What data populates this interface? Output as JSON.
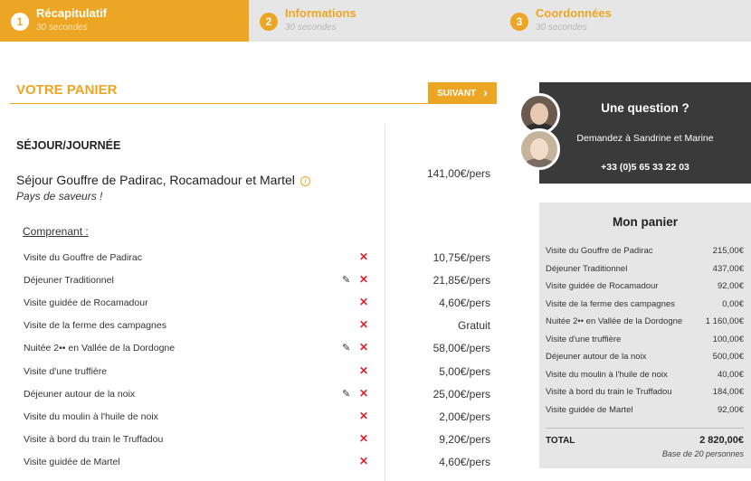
{
  "steps": [
    {
      "number": "1",
      "title": "Récapitulatif",
      "subtitle": "30 secondes"
    },
    {
      "number": "2",
      "title": "Informations",
      "subtitle": "30 secondes"
    },
    {
      "number": "3",
      "title": "Coordonnées",
      "subtitle": "30 secondes"
    }
  ],
  "panier": {
    "title": "VOTRE PANIER",
    "next_label": "SUIVANT",
    "section_title": "SÉJOUR/JOURNÉE",
    "sejour_name": "Séjour Gouffre de Padirac, Rocamadour et Martel",
    "sejour_subtitle": "Pays de saveurs !",
    "sejour_price": "141,00€/pers",
    "comprenant_label": "Comprenant :",
    "items": [
      {
        "name": "Visite du Gouffre de Padirac",
        "price": "10,75€/pers",
        "editable": false
      },
      {
        "name": "Déjeuner Traditionnel",
        "price": "21,85€/pers",
        "editable": true
      },
      {
        "name": "Visite guidée de Rocamadour",
        "price": "4,60€/pers",
        "editable": false
      },
      {
        "name": "Visite de la ferme des campagnes",
        "price": "Gratuit",
        "editable": false
      },
      {
        "name": "Nuitée 2•• en Vallée de la Dordogne",
        "price": "58,00€/pers",
        "editable": true
      },
      {
        "name": "Visite d'une truffière",
        "price": "5,00€/pers",
        "editable": false
      },
      {
        "name": "Déjeuner autour de la noix",
        "price": "25,00€/pers",
        "editable": true
      },
      {
        "name": "Visite du moulin à l'huile de noix",
        "price": "2,00€/pers",
        "editable": false
      },
      {
        "name": "Visite à bord du train le Truffadou",
        "price": "9,20€/pers",
        "editable": false
      },
      {
        "name": "Visite guidée de Martel",
        "price": "4,60€/pers",
        "editable": false
      }
    ]
  },
  "question": {
    "title": "Une question ?",
    "subtitle": "Demandez à Sandrine et Marine",
    "phone": "+33 (0)5 65 33 22 03"
  },
  "cart": {
    "title": "Mon panier",
    "rows": [
      {
        "name": "Visite du Gouffre de Padirac",
        "value": "215,00€"
      },
      {
        "name": "Déjeuner Traditionnel",
        "value": "437,00€"
      },
      {
        "name": "Visite guidée de Rocamadour",
        "value": "92,00€"
      },
      {
        "name": "Visite de la ferme des campagnes",
        "value": "0,00€"
      },
      {
        "name": "Nuitée 2•• en Vallée de la Dordogne",
        "value": "1 160,00€"
      },
      {
        "name": "Visite d'une truffière",
        "value": "100,00€"
      },
      {
        "name": "Déjeuner autour de la noix",
        "value": "500,00€"
      },
      {
        "name": "Visite du moulin à l'huile de noix",
        "value": "40,00€"
      },
      {
        "name": "Visite à bord du train le Truffadou",
        "value": "184,00€"
      },
      {
        "name": "Visite guidée de Martel",
        "value": "92,00€"
      }
    ],
    "total_label": "TOTAL",
    "total_value": "2 820,00€",
    "base_note": "Base de 20 personnes"
  },
  "colors": {
    "accent": "#eda624",
    "delete": "#e0242f",
    "dark_box": "#3a3a3a",
    "cart_bg": "#e6e6e6"
  },
  "icons": {
    "next": "chevron-right-icon",
    "edit": "pencil-icon",
    "delete": "close-icon",
    "info": "info-icon"
  }
}
